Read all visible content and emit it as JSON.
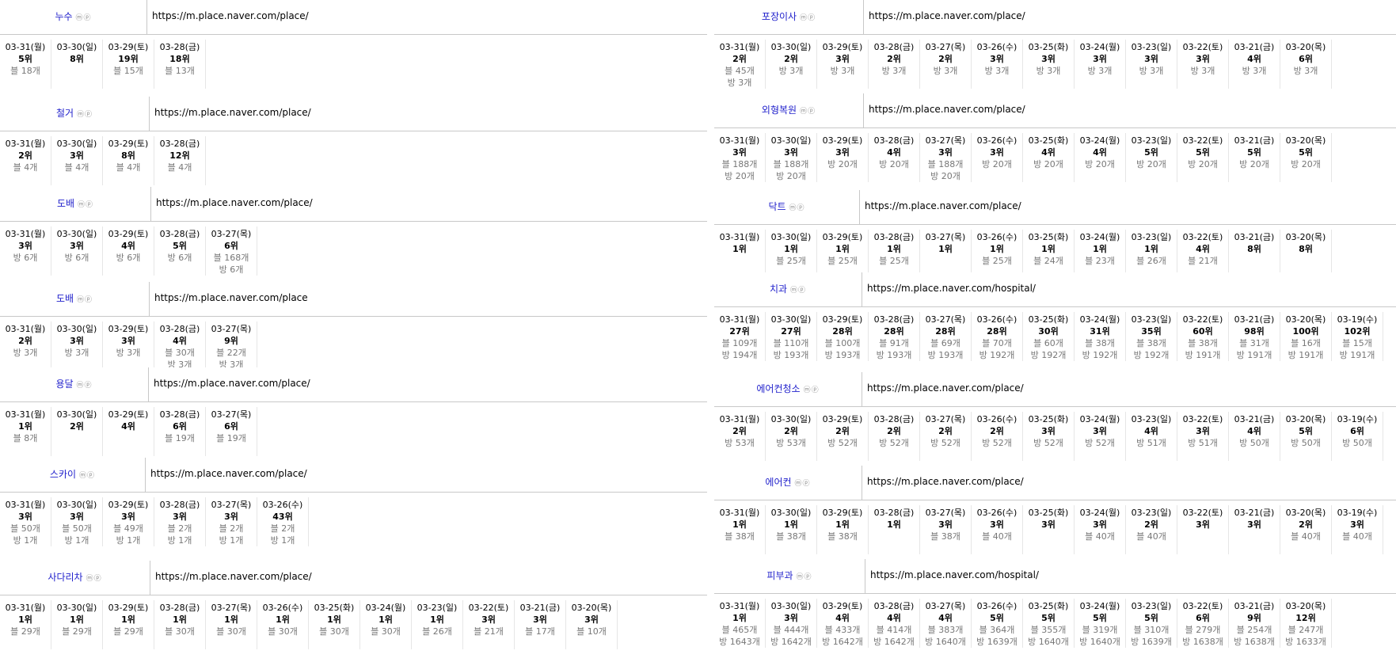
{
  "icon_text": "ⓜⓟ",
  "panels": [
    {
      "keyword": "누수",
      "url": "https://m.place.naver.com/place/",
      "kw_w": 185,
      "box": [
        0,
        0,
        893,
        118
      ],
      "cells": [
        [
          "03-31(월)",
          "5위",
          "블 18개",
          ""
        ],
        [
          "03-30(일)",
          "8위",
          "",
          ""
        ],
        [
          "03-29(토)",
          "19위",
          "블 15개",
          ""
        ],
        [
          "03-28(금)",
          "18위",
          "블 13개",
          ""
        ]
      ]
    },
    {
      "keyword": "철거",
      "url": "https://m.place.naver.com/place/",
      "kw_w": 188,
      "box": [
        0,
        122,
        893,
        118
      ],
      "cells": [
        [
          "03-31(월)",
          "2위",
          "블 4개",
          ""
        ],
        [
          "03-30(일)",
          "3위",
          "블 4개",
          ""
        ],
        [
          "03-29(토)",
          "8위",
          "블 4개",
          ""
        ],
        [
          "03-28(금)",
          "12위",
          "블 4개",
          ""
        ]
      ]
    },
    {
      "keyword": "도배",
      "url": "https://m.place.naver.com/place/",
      "kw_w": 190,
      "box": [
        0,
        236,
        893,
        118
      ],
      "cells": [
        [
          "03-31(월)",
          "3위",
          "방 6개",
          ""
        ],
        [
          "03-30(일)",
          "3위",
          "방 6개",
          ""
        ],
        [
          "03-29(토)",
          "4위",
          "방 6개",
          ""
        ],
        [
          "03-28(금)",
          "5위",
          "방 6개",
          ""
        ],
        [
          "03-27(목)",
          "6위",
          "블 168개",
          "방 6개"
        ]
      ]
    },
    {
      "keyword": "도배",
      "url": "https://m.place.naver.com/place",
      "kw_w": 188,
      "box": [
        0,
        356,
        893,
        112
      ],
      "cells": [
        [
          "03-31(월)",
          "2위",
          "방 3개",
          ""
        ],
        [
          "03-30(일)",
          "3위",
          "방 3개",
          ""
        ],
        [
          "03-29(토)",
          "3위",
          "방 3개",
          ""
        ],
        [
          "03-28(금)",
          "4위",
          "블 30개",
          "방 3개"
        ],
        [
          "03-27(목)",
          "9위",
          "블 22개",
          "방 3개"
        ]
      ]
    },
    {
      "keyword": "용달",
      "url": "https://m.place.naver.com/place/",
      "kw_w": 187,
      "box": [
        0,
        464,
        893,
        118
      ],
      "cells": [
        [
          "03-31(월)",
          "1위",
          "블 8개",
          ""
        ],
        [
          "03-30(일)",
          "2위",
          "",
          ""
        ],
        [
          "03-29(토)",
          "4위",
          "",
          ""
        ],
        [
          "03-28(금)",
          "6위",
          "블 19개",
          ""
        ],
        [
          "03-27(목)",
          "6위",
          "블 19개",
          ""
        ]
      ]
    },
    {
      "keyword": "스카이",
      "url": "https://m.place.naver.com/place/",
      "kw_w": 183,
      "box": [
        0,
        578,
        893,
        122
      ],
      "cells": [
        [
          "03-31(월)",
          "3위",
          "블 50개",
          "방 1개"
        ],
        [
          "03-30(일)",
          "3위",
          "블 50개",
          "방 1개"
        ],
        [
          "03-29(토)",
          "3위",
          "블 49개",
          "방 1개"
        ],
        [
          "03-28(금)",
          "3위",
          "블 2개",
          "방 1개"
        ],
        [
          "03-27(목)",
          "3위",
          "블 2개",
          "방 1개"
        ],
        [
          "03-26(수)",
          "43위",
          "블 2개",
          "방 1개"
        ]
      ]
    },
    {
      "keyword": "사다리차",
      "url": "https://m.place.naver.com/place/",
      "kw_w": 189,
      "box": [
        0,
        708,
        893,
        128
      ],
      "cells": [
        [
          "03-31(월)",
          "1위",
          "블 29개",
          ""
        ],
        [
          "03-30(일)",
          "1위",
          "블 29개",
          ""
        ],
        [
          "03-29(토)",
          "1위",
          "블 29개",
          ""
        ],
        [
          "03-28(금)",
          "1위",
          "블 30개",
          ""
        ],
        [
          "03-27(목)",
          "1위",
          "블 30개",
          ""
        ],
        [
          "03-26(수)",
          "1위",
          "블 30개",
          ""
        ],
        [
          "03-25(화)",
          "1위",
          "블 30개",
          ""
        ],
        [
          "03-24(월)",
          "1위",
          "블 30개",
          ""
        ],
        [
          "03-23(일)",
          "1위",
          "블 26개",
          ""
        ],
        [
          "03-22(토)",
          "3위",
          "블 21개",
          ""
        ],
        [
          "03-21(금)",
          "3위",
          "블 17개",
          ""
        ],
        [
          "03-20(목)",
          "3위",
          "블 10개",
          ""
        ]
      ]
    },
    {
      "keyword": "포장이사",
      "url": "https://m.place.naver.com/place/",
      "kw_w": 188,
      "box": [
        902,
        0,
        861,
        118
      ],
      "cells": [
        [
          "03-31(월)",
          "2위",
          "블 45개",
          "방 3개"
        ],
        [
          "03-30(일)",
          "2위",
          "방 3개",
          ""
        ],
        [
          "03-29(토)",
          "3위",
          "방 3개",
          ""
        ],
        [
          "03-28(금)",
          "2위",
          "방 3개",
          ""
        ],
        [
          "03-27(목)",
          "2위",
          "방 3개",
          ""
        ],
        [
          "03-26(수)",
          "3위",
          "방 3개",
          ""
        ],
        [
          "03-25(화)",
          "3위",
          "방 3개",
          ""
        ],
        [
          "03-24(월)",
          "3위",
          "방 3개",
          ""
        ],
        [
          "03-23(일)",
          "3위",
          "방 3개",
          ""
        ],
        [
          "03-22(토)",
          "3위",
          "방 3개",
          ""
        ],
        [
          "03-21(금)",
          "4위",
          "방 3개",
          ""
        ],
        [
          "03-20(목)",
          "6위",
          "방 3개",
          ""
        ]
      ]
    },
    {
      "keyword": "외형복원",
      "url": "https://m.place.naver.com/place/",
      "kw_w": 188,
      "box": [
        902,
        118,
        861,
        118
      ],
      "cells": [
        [
          "03-31(월)",
          "3위",
          "블 188개",
          "방 20개"
        ],
        [
          "03-30(일)",
          "3위",
          "블 188개",
          "방 20개"
        ],
        [
          "03-29(토)",
          "3위",
          "방 20개",
          ""
        ],
        [
          "03-28(금)",
          "4위",
          "방 20개",
          ""
        ],
        [
          "03-27(목)",
          "3위",
          "블 188개",
          "방 20개"
        ],
        [
          "03-26(수)",
          "3위",
          "방 20개",
          ""
        ],
        [
          "03-25(화)",
          "4위",
          "방 20개",
          ""
        ],
        [
          "03-24(월)",
          "4위",
          "방 20개",
          ""
        ],
        [
          "03-23(일)",
          "5위",
          "방 20개",
          ""
        ],
        [
          "03-22(토)",
          "5위",
          "방 20개",
          ""
        ],
        [
          "03-21(금)",
          "5위",
          "방 20개",
          ""
        ],
        [
          "03-20(목)",
          "5위",
          "방 20개",
          ""
        ]
      ]
    },
    {
      "keyword": "닥트",
      "url": "https://m.place.naver.com/place/",
      "kw_w": 183,
      "box": [
        902,
        240,
        861,
        104
      ],
      "cells": [
        [
          "03-31(월)",
          "1위",
          "",
          ""
        ],
        [
          "03-30(일)",
          "1위",
          "블 25개",
          ""
        ],
        [
          "03-29(토)",
          "1위",
          "블 25개",
          ""
        ],
        [
          "03-28(금)",
          "1위",
          "블 25개",
          ""
        ],
        [
          "03-27(목)",
          "1위",
          "",
          ""
        ],
        [
          "03-26(수)",
          "1위",
          "블 25개",
          ""
        ],
        [
          "03-25(화)",
          "1위",
          "블 24개",
          ""
        ],
        [
          "03-24(월)",
          "1위",
          "블 23개",
          ""
        ],
        [
          "03-23(일)",
          "1위",
          "블 26개",
          ""
        ],
        [
          "03-22(토)",
          "4위",
          "블 21개",
          ""
        ],
        [
          "03-21(금)",
          "8위",
          "",
          ""
        ],
        [
          "03-20(목)",
          "8위",
          "",
          ""
        ]
      ]
    },
    {
      "keyword": "치과",
      "url": "https://m.place.naver.com/hospital/",
      "kw_w": 186,
      "box": [
        902,
        344,
        861,
        118
      ],
      "cells": [
        [
          "03-31(월)",
          "27위",
          "블 109개",
          "방 194개"
        ],
        [
          "03-30(일)",
          "27위",
          "블 110개",
          "방 193개"
        ],
        [
          "03-29(토)",
          "28위",
          "블 100개",
          "방 193개"
        ],
        [
          "03-28(금)",
          "28위",
          "블 91개",
          "방 193개"
        ],
        [
          "03-27(목)",
          "28위",
          "블 69개",
          "방 193개"
        ],
        [
          "03-26(수)",
          "28위",
          "블 70개",
          "방 192개"
        ],
        [
          "03-25(화)",
          "30위",
          "블 60개",
          "방 192개"
        ],
        [
          "03-24(월)",
          "31위",
          "블 38개",
          "방 192개"
        ],
        [
          "03-23(일)",
          "35위",
          "블 38개",
          "방 192개"
        ],
        [
          "03-22(토)",
          "60위",
          "블 38개",
          "방 191개"
        ],
        [
          "03-21(금)",
          "98위",
          "블 31개",
          "방 191개"
        ],
        [
          "03-20(목)",
          "100위",
          "블 16개",
          "방 191개"
        ],
        [
          "03-19(수)",
          "102위",
          "블 15개",
          "방 191개"
        ]
      ]
    },
    {
      "keyword": "에어컨청소",
      "url": "https://m.place.naver.com/place/",
      "kw_w": 186,
      "box": [
        902,
        470,
        861,
        116
      ],
      "cells": [
        [
          "03-31(월)",
          "2위",
          "방 53개",
          ""
        ],
        [
          "03-30(일)",
          "2위",
          "방 53개",
          ""
        ],
        [
          "03-29(토)",
          "2위",
          "방 52개",
          ""
        ],
        [
          "03-28(금)",
          "2위",
          "방 52개",
          ""
        ],
        [
          "03-27(목)",
          "2위",
          "방 52개",
          ""
        ],
        [
          "03-26(수)",
          "2위",
          "방 52개",
          ""
        ],
        [
          "03-25(화)",
          "3위",
          "방 52개",
          ""
        ],
        [
          "03-24(월)",
          "3위",
          "방 52개",
          ""
        ],
        [
          "03-23(일)",
          "4위",
          "방 51개",
          ""
        ],
        [
          "03-22(토)",
          "3위",
          "방 51개",
          ""
        ],
        [
          "03-21(금)",
          "4위",
          "방 50개",
          ""
        ],
        [
          "03-20(목)",
          "5위",
          "방 50개",
          ""
        ],
        [
          "03-19(수)",
          "6위",
          "방 50개",
          ""
        ]
      ]
    },
    {
      "keyword": "에어컨",
      "url": "https://m.place.naver.com/place/",
      "kw_w": 186,
      "box": [
        902,
        588,
        861,
        118
      ],
      "cells": [
        [
          "03-31(월)",
          "1위",
          "블 38개",
          ""
        ],
        [
          "03-30(일)",
          "1위",
          "블 38개",
          ""
        ],
        [
          "03-29(토)",
          "1위",
          "블 38개",
          ""
        ],
        [
          "03-28(금)",
          "1위",
          "",
          ""
        ],
        [
          "03-27(목)",
          "3위",
          "블 38개",
          ""
        ],
        [
          "03-26(수)",
          "3위",
          "블 40개",
          ""
        ],
        [
          "03-25(화)",
          "3위",
          "",
          ""
        ],
        [
          "03-24(월)",
          "3위",
          "블 40개",
          ""
        ],
        [
          "03-23(일)",
          "2위",
          "블 40개",
          ""
        ],
        [
          "03-22(토)",
          "3위",
          "",
          ""
        ],
        [
          "03-21(금)",
          "3위",
          "",
          ""
        ],
        [
          "03-20(목)",
          "2위",
          "블 40개",
          ""
        ],
        [
          "03-19(수)",
          "3위",
          "블 40개",
          ""
        ]
      ]
    },
    {
      "keyword": "피부과",
      "url": "https://m.place.naver.com/hospital/",
      "kw_w": 190,
      "box": [
        902,
        706,
        861,
        130
      ],
      "cells": [
        [
          "03-31(월)",
          "1위",
          "블 465개",
          "방 1643개"
        ],
        [
          "03-30(일)",
          "3위",
          "블 444개",
          "방 1642개"
        ],
        [
          "03-29(토)",
          "4위",
          "블 433개",
          "방 1642개"
        ],
        [
          "03-28(금)",
          "4위",
          "블 414개",
          "방 1642개"
        ],
        [
          "03-27(목)",
          "4위",
          "블 383개",
          "방 1640개"
        ],
        [
          "03-26(수)",
          "5위",
          "블 364개",
          "방 1639개"
        ],
        [
          "03-25(화)",
          "5위",
          "블 355개",
          "방 1640개"
        ],
        [
          "03-24(월)",
          "5위",
          "블 319개",
          "방 1640개"
        ],
        [
          "03-23(일)",
          "5위",
          "블 310개",
          "방 1639개"
        ],
        [
          "03-22(토)",
          "6위",
          "블 279개",
          "방 1638개"
        ],
        [
          "03-21(금)",
          "9위",
          "블 254개",
          "방 1638개"
        ],
        [
          "03-20(목)",
          "12위",
          "블 247개",
          "방 1633개"
        ]
      ]
    }
  ]
}
